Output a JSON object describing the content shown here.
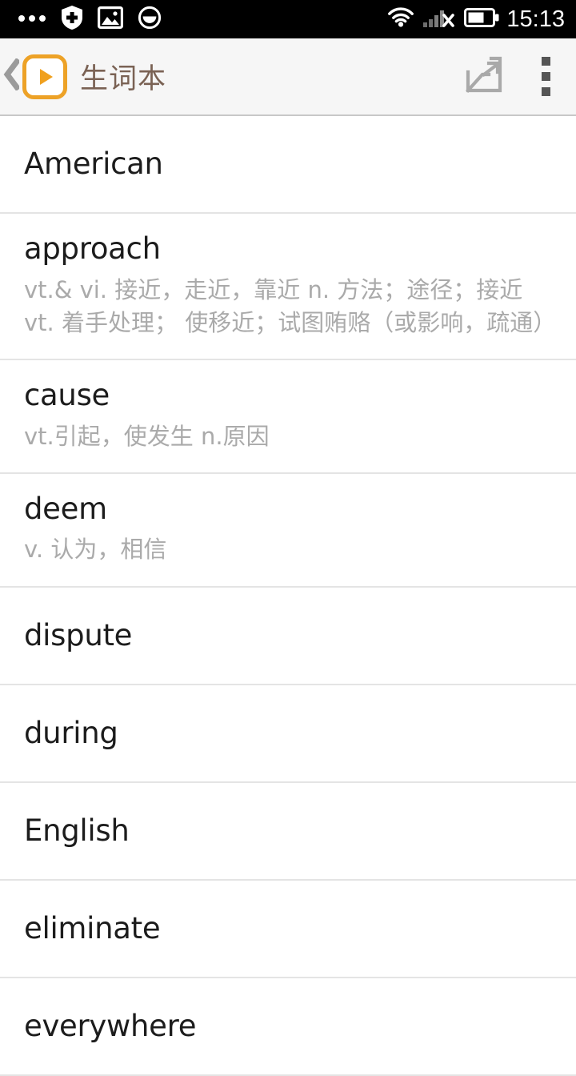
{
  "status_bar": {
    "time": "15:13",
    "left_icons": [
      "more-dots-icon",
      "security-shield-icon",
      "image-icon",
      "circle-half-icon"
    ],
    "right_icons": [
      "wifi-icon",
      "signal-no-sim-icon",
      "battery-icon"
    ],
    "battery_level_percent": 60,
    "background_color": "#000000",
    "foreground_color": "#ffffff"
  },
  "app_bar": {
    "back_label": "‹",
    "app_icon_name": "app-logo-play-icon",
    "title": "生词本",
    "title_color": "#7a6254",
    "accent_color": "#eda227",
    "background_color": "#f6f6f6",
    "share_icon_name": "share-export-icon",
    "overflow_icon_name": "overflow-menu-icon"
  },
  "word_list": {
    "items": [
      {
        "term": "American",
        "definition": ""
      },
      {
        "term": "approach",
        "definition": "vt.& vi. 接近，走近，靠近  n. 方法；途径；接近 vt. 着手处理； 使移近；试图贿赂（或影响，疏通）"
      },
      {
        "term": "cause",
        "definition": "vt.引起，使发生  n.原因"
      },
      {
        "term": "deem",
        "definition": "v. 认为，相信"
      },
      {
        "term": "dispute",
        "definition": ""
      },
      {
        "term": "during",
        "definition": ""
      },
      {
        "term": "English",
        "definition": ""
      },
      {
        "term": "eliminate",
        "definition": ""
      },
      {
        "term": "everywhere",
        "definition": ""
      }
    ]
  }
}
